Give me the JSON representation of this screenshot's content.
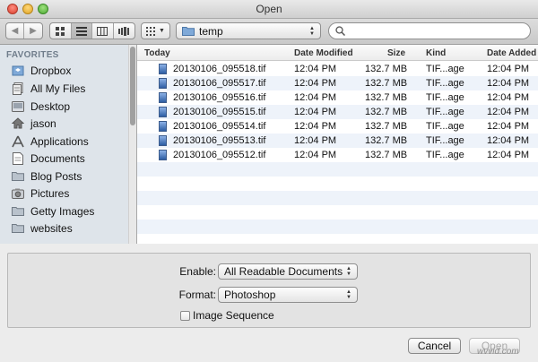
{
  "window": {
    "title": "Open"
  },
  "toolbar": {
    "back_icon": "chevron-left-icon",
    "forward_icon": "chevron-right-icon",
    "view_modes": [
      "icon-view",
      "list-view",
      "column-view",
      "coverflow-view"
    ],
    "selected_view": "list-view",
    "location": "temp",
    "search": {
      "value": "",
      "placeholder": ""
    }
  },
  "sidebar": {
    "heading": "FAVORITES",
    "items": [
      {
        "label": "Dropbox",
        "icon": "dropbox-icon"
      },
      {
        "label": "All My Files",
        "icon": "all-files-icon"
      },
      {
        "label": "Desktop",
        "icon": "desktop-icon"
      },
      {
        "label": "jason",
        "icon": "home-icon"
      },
      {
        "label": "Applications",
        "icon": "applications-icon"
      },
      {
        "label": "Documents",
        "icon": "documents-icon"
      },
      {
        "label": "Blog Posts",
        "icon": "folder-icon"
      },
      {
        "label": "Pictures",
        "icon": "pictures-icon"
      },
      {
        "label": "Getty Images",
        "icon": "folder-icon"
      },
      {
        "label": "websites",
        "icon": "folder-icon"
      }
    ]
  },
  "filelist": {
    "columns": [
      "Today",
      "Date Modified",
      "Size",
      "Kind",
      "Date Added"
    ],
    "rows": [
      {
        "name": "20130106_095518.tif",
        "modified": "12:04 PM",
        "size": "132.7 MB",
        "kind": "TIF...age",
        "added": "12:04 PM"
      },
      {
        "name": "20130106_095517.tif",
        "modified": "12:04 PM",
        "size": "132.7 MB",
        "kind": "TIF...age",
        "added": "12:04 PM"
      },
      {
        "name": "20130106_095516.tif",
        "modified": "12:04 PM",
        "size": "132.7 MB",
        "kind": "TIF...age",
        "added": "12:04 PM"
      },
      {
        "name": "20130106_095515.tif",
        "modified": "12:04 PM",
        "size": "132.7 MB",
        "kind": "TIF...age",
        "added": "12:04 PM"
      },
      {
        "name": "20130106_095514.tif",
        "modified": "12:04 PM",
        "size": "132.7 MB",
        "kind": "TIF...age",
        "added": "12:04 PM"
      },
      {
        "name": "20130106_095513.tif",
        "modified": "12:04 PM",
        "size": "132.7 MB",
        "kind": "TIF...age",
        "added": "12:04 PM"
      },
      {
        "name": "20130106_095512.tif",
        "modified": "12:04 PM",
        "size": "132.7 MB",
        "kind": "TIF...age",
        "added": "12:04 PM"
      }
    ]
  },
  "options": {
    "enable_label": "Enable:",
    "enable_value": "All Readable Documents",
    "format_label": "Format:",
    "format_value": "Photoshop",
    "image_sequence_label": "Image Sequence",
    "image_sequence_checked": false
  },
  "buttons": {
    "cancel": "Cancel",
    "open": "Open"
  },
  "watermark": "wvvid.com"
}
